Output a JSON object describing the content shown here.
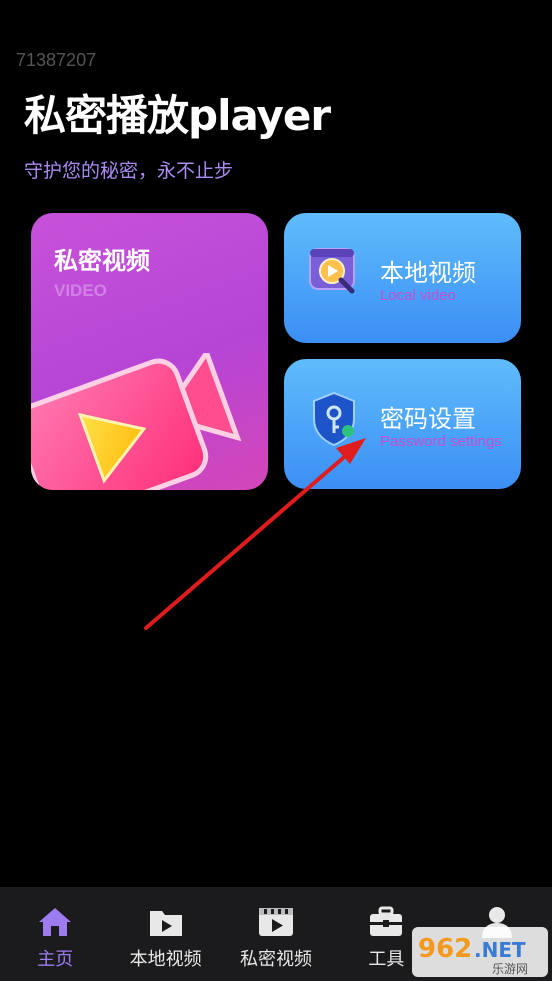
{
  "header": {
    "id_text": "71387207",
    "title": "私密播放player",
    "subtitle": "守护您的秘密，永不止步"
  },
  "cards": {
    "private_video": {
      "title": "私密视频",
      "subtitle": "VIDEO"
    },
    "local_video": {
      "title": "本地视频",
      "subtitle": "Local video"
    },
    "password_settings": {
      "title": "密码设置",
      "subtitle": "Password settings"
    }
  },
  "bottom_nav": {
    "items": [
      {
        "label": "主页",
        "icon": "home-icon",
        "active": true
      },
      {
        "label": "本地视频",
        "icon": "folder-play-icon"
      },
      {
        "label": "私密视频",
        "icon": "film-play-icon"
      },
      {
        "label": "工具",
        "icon": "toolbox-icon"
      },
      {
        "label": "",
        "icon": "user-icon"
      }
    ]
  },
  "watermark": {
    "text": "962.NET",
    "subtext": "乐游网"
  },
  "colors": {
    "accent_purple": "#9d7cf2",
    "card_pink": "#c752d9",
    "card_blue": "#4aa6f8",
    "annotation_red": "#e01c1c"
  }
}
